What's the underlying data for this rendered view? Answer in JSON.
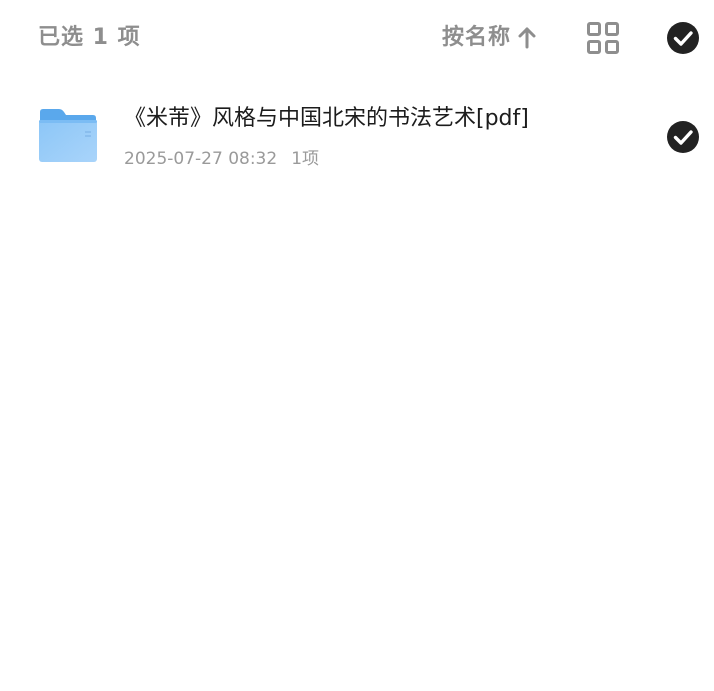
{
  "toolbar": {
    "selected_label": "已选 1 项",
    "sort_label": "按名称",
    "sort_direction_icon": "arrow-up-icon",
    "view_toggle_icon": "grid-view-icon",
    "select_all_icon": "check-circle-icon"
  },
  "files": [
    {
      "name": "《米芾》风格与中国北宋的书法艺术[pdf]",
      "date": "2025-07-27 08:32",
      "count": "1项",
      "icon": "folder-icon",
      "selected": true
    }
  ],
  "colors": {
    "muted_text": "#8e8e8e",
    "primary_text": "#1c1c1c",
    "meta_text": "#9a9a9a",
    "check_fill": "#222222",
    "folder_blue": "#6fb3f2"
  }
}
